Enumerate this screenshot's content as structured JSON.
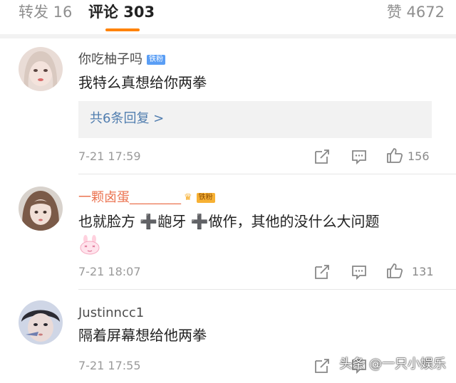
{
  "tabs": {
    "reposts": "转发 16",
    "comments": "评论 303",
    "likes": "赞 4672"
  },
  "comments": [
    {
      "username": "你吃柚子吗",
      "badge": "铁粉",
      "text": "我特么真想给你两拳",
      "replies_link": "共6条回复 >",
      "time": "7-21 17:59",
      "likes": "156"
    },
    {
      "username": "一颗卤蛋________",
      "badge": "铁粉",
      "text": "也就脸方 ➕龅牙 ➕做作，其他的没什么大问题",
      "time": "7-21 18:07",
      "likes": "131"
    },
    {
      "username": "Justinncc1",
      "text": "隔着屏幕想给他两拳",
      "time": "7-21 17:55"
    }
  ],
  "watermark": "头条 @一只小娱乐",
  "colors": {
    "accent": "#ff8200",
    "link": "#507daf",
    "vip_name": "#eb7350"
  }
}
